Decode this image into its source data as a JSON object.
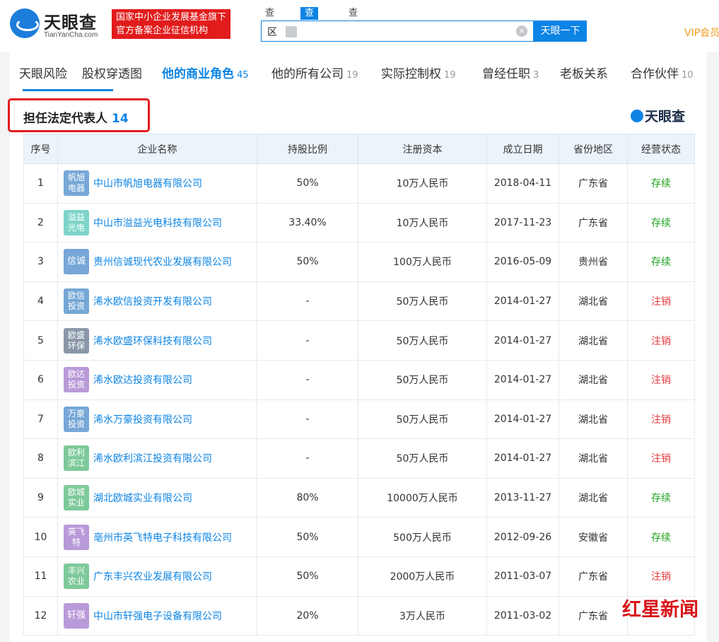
{
  "header": {
    "logo_cn": "天眼查",
    "logo_en": "TianYanCha.com",
    "badge_line1": "国家中小企业发展基金旗下",
    "badge_line2": "官方备案企业征信机构",
    "search_tabs": [
      "查公司",
      "查老板",
      "查关系"
    ],
    "search_value": "区",
    "search_button": "天眼一下",
    "vip": "VIP会员"
  },
  "nav": {
    "tabs": [
      {
        "label": "天眼风险",
        "count": ""
      },
      {
        "label": "股权穿透图",
        "count": ""
      },
      {
        "label": "他的商业角色",
        "count": "45"
      },
      {
        "label": "他的所有公司",
        "count": "19"
      },
      {
        "label": "实际控制权",
        "count": "19"
      },
      {
        "label": "曾经任职",
        "count": "3"
      },
      {
        "label": "老板关系",
        "count": ""
      },
      {
        "label": "合作伙伴",
        "count": "10"
      }
    ]
  },
  "section": {
    "title": "担任法定代表人",
    "count": "14",
    "brand": "天眼查"
  },
  "table": {
    "headers": [
      "序号",
      "企业名称",
      "持股比例",
      "注册资本",
      "成立日期",
      "省份地区",
      "经营状态"
    ],
    "rows": [
      {
        "no": "1",
        "logo1": "帆旭",
        "logo2": "电器",
        "logo_color": "#76a7d6",
        "name": "中山市帆旭电器有限公司",
        "share": "50%",
        "capital": "10万人民币",
        "date": "2018-04-11",
        "region": "广东省",
        "status": "存续",
        "status_type": "ok"
      },
      {
        "no": "2",
        "logo1": "溢益",
        "logo2": "光电",
        "logo_color": "#7dd4c8",
        "name": "中山市溢益光电科技有限公司",
        "share": "33.40%",
        "capital": "10万人民币",
        "date": "2017-11-23",
        "region": "广东省",
        "status": "存续",
        "status_type": "ok"
      },
      {
        "no": "3",
        "logo1": "信诚",
        "logo2": "",
        "logo_color": "#76a7d6",
        "name": "贵州信诚现代农业发展有限公司",
        "share": "50%",
        "capital": "100万人民币",
        "date": "2016-05-09",
        "region": "贵州省",
        "status": "存续",
        "status_type": "ok"
      },
      {
        "no": "4",
        "logo1": "欧信",
        "logo2": "投资",
        "logo_color": "#76a7d6",
        "name": "浠水欧信投资开发有限公司",
        "share": "-",
        "capital": "50万人民币",
        "date": "2014-01-27",
        "region": "湖北省",
        "status": "注销",
        "status_type": "off"
      },
      {
        "no": "5",
        "logo1": "欧盛",
        "logo2": "环保",
        "logo_color": "#8b97a8",
        "name": "浠水欧盛环保科技有限公司",
        "share": "-",
        "capital": "50万人民币",
        "date": "2014-01-27",
        "region": "湖北省",
        "status": "注销",
        "status_type": "off"
      },
      {
        "no": "6",
        "logo1": "欧达",
        "logo2": "投资",
        "logo_color": "#b99ad8",
        "name": "浠水欧达投资有限公司",
        "share": "-",
        "capital": "50万人民币",
        "date": "2014-01-27",
        "region": "湖北省",
        "status": "注销",
        "status_type": "off"
      },
      {
        "no": "7",
        "logo1": "万豪",
        "logo2": "投资",
        "logo_color": "#76a7d6",
        "name": "浠水万豪投资有限公司",
        "share": "-",
        "capital": "50万人民币",
        "date": "2014-01-27",
        "region": "湖北省",
        "status": "注销",
        "status_type": "off"
      },
      {
        "no": "8",
        "logo1": "欧利",
        "logo2": "滨江",
        "logo_color": "#7dc99a",
        "name": "浠水欧利滨江投资有限公司",
        "share": "-",
        "capital": "50万人民币",
        "date": "2014-01-27",
        "region": "湖北省",
        "status": "注销",
        "status_type": "off"
      },
      {
        "no": "9",
        "logo1": "欧城",
        "logo2": "实业",
        "logo_color": "#7dc99a",
        "name": "湖北欧城实业有限公司",
        "share": "80%",
        "capital": "10000万人民币",
        "date": "2013-11-27",
        "region": "湖北省",
        "status": "存续",
        "status_type": "ok"
      },
      {
        "no": "10",
        "logo1": "英飞",
        "logo2": "特",
        "logo_color": "#b99ad8",
        "name": "亳州市英飞特电子科技有限公司",
        "share": "50%",
        "capital": "500万人民币",
        "date": "2012-09-26",
        "region": "安徽省",
        "status": "存续",
        "status_type": "ok"
      },
      {
        "no": "11",
        "logo1": "丰兴",
        "logo2": "农业",
        "logo_color": "#7dc99a",
        "name": "广东丰兴农业发展有限公司",
        "share": "50%",
        "capital": "2000万人民币",
        "date": "2011-03-07",
        "region": "广东省",
        "status": "注销",
        "status_type": "off"
      },
      {
        "no": "12",
        "logo1": "轩强",
        "logo2": "",
        "logo_color": "#b99ad8",
        "name": "中山市轩强电子设备有限公司",
        "share": "20%",
        "capital": "3万人民币",
        "date": "2011-03-02",
        "region": "广东省",
        "status": "",
        "status_type": "ok"
      }
    ]
  },
  "watermark": "红星新闻"
}
